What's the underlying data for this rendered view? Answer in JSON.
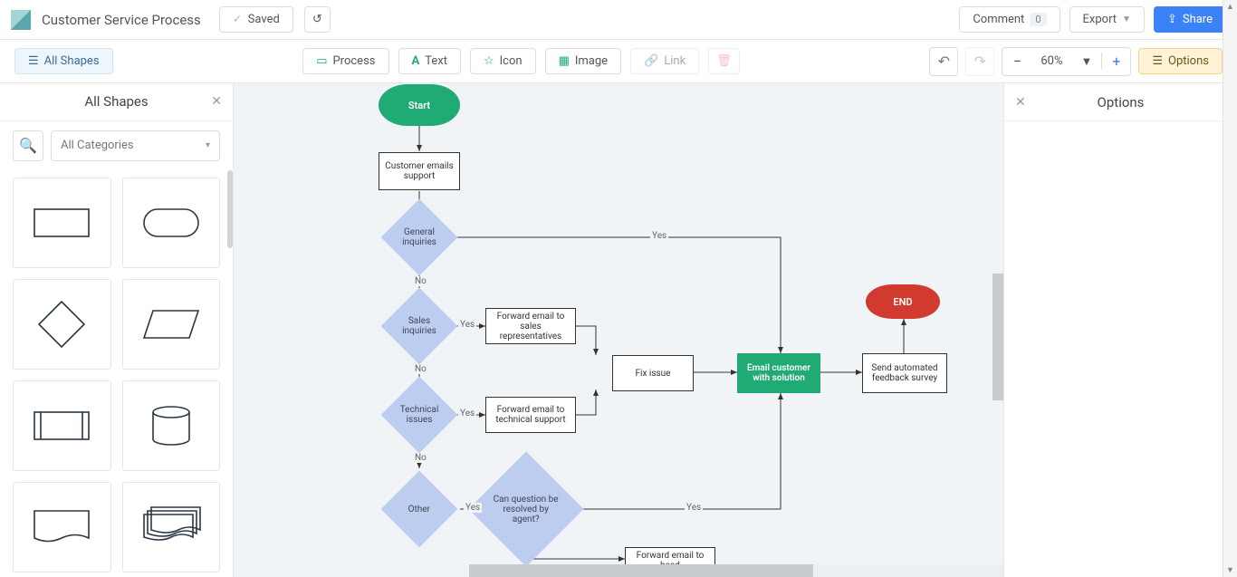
{
  "header": {
    "title": "Customer Service Process",
    "saved_label": "Saved",
    "comment_label": "Comment",
    "comment_count": "0",
    "export_label": "Export",
    "share_label": "Share"
  },
  "toolbar": {
    "all_shapes": "All Shapes",
    "process": "Process",
    "text": "Text",
    "icon": "Icon",
    "image": "Image",
    "link": "Link",
    "zoom": "60%",
    "options": "Options"
  },
  "left_panel": {
    "title": "All Shapes",
    "category": "All Categories"
  },
  "right_panel": {
    "title": "Options"
  },
  "flow": {
    "start": "Start",
    "end": "END",
    "n1": "Customer emails support",
    "d1": "General inquiries",
    "d2": "Sales inquiries",
    "d3": "Technical issues",
    "d4": "Other",
    "d5": "Can question be resolved by agent?",
    "n2": "Forward email to sales representatives",
    "n3": "Forward email to technical support",
    "n4": "Fix issue",
    "n5": "Email customer with solution",
    "n6": "Send automated feedback survey",
    "n7": "Forward email to head",
    "yes": "Yes",
    "no": "No"
  }
}
